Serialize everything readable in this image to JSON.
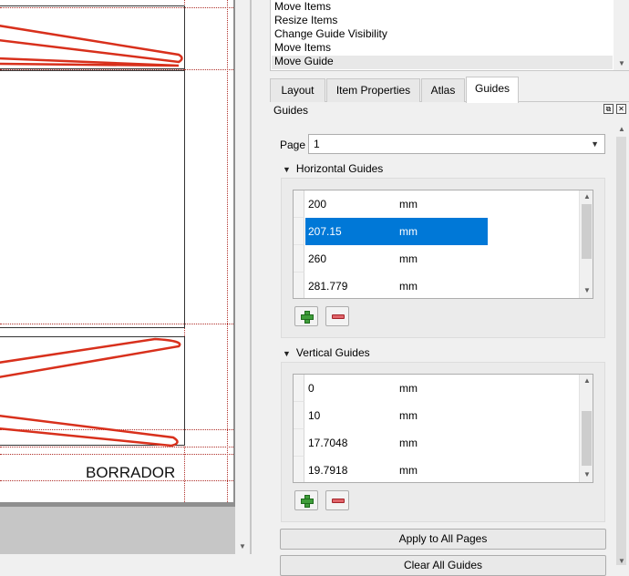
{
  "canvas": {
    "watermark": "BORRADOR"
  },
  "undo_history": {
    "items": [
      "Move Items",
      "Resize Items",
      "Change Guide Visibility",
      "Move Items",
      "Move Guide"
    ]
  },
  "tabs": [
    {
      "label": "Layout"
    },
    {
      "label": "Item Properties"
    },
    {
      "label": "Atlas"
    },
    {
      "label": "Guides"
    }
  ],
  "guides_panel": {
    "title": "Guides",
    "page_label": "Page",
    "page_value": "1",
    "horizontal": {
      "title": "Horizontal Guides",
      "rows": [
        {
          "value": "200",
          "unit": "mm"
        },
        {
          "value": "207.15",
          "unit": "mm"
        },
        {
          "value": "260",
          "unit": "mm"
        },
        {
          "value": "281.779",
          "unit": "mm"
        }
      ]
    },
    "vertical": {
      "title": "Vertical Guides",
      "rows": [
        {
          "value": "0",
          "unit": "mm"
        },
        {
          "value": "10",
          "unit": "mm"
        },
        {
          "value": "17.7048",
          "unit": "mm"
        },
        {
          "value": "19.7918",
          "unit": "mm"
        }
      ]
    },
    "apply_all_label": "Apply to All Pages",
    "clear_all_label": "Clear All Guides"
  },
  "icons": {
    "tab_float": "float-icon",
    "tab_close": "close-icon",
    "add": "plus-icon",
    "remove": "minus-icon",
    "collapse": "triangle-down-icon"
  },
  "colors": {
    "selection": "#0078d7",
    "guide_line": "#b0302a",
    "arrow_stroke": "#d8301c"
  }
}
